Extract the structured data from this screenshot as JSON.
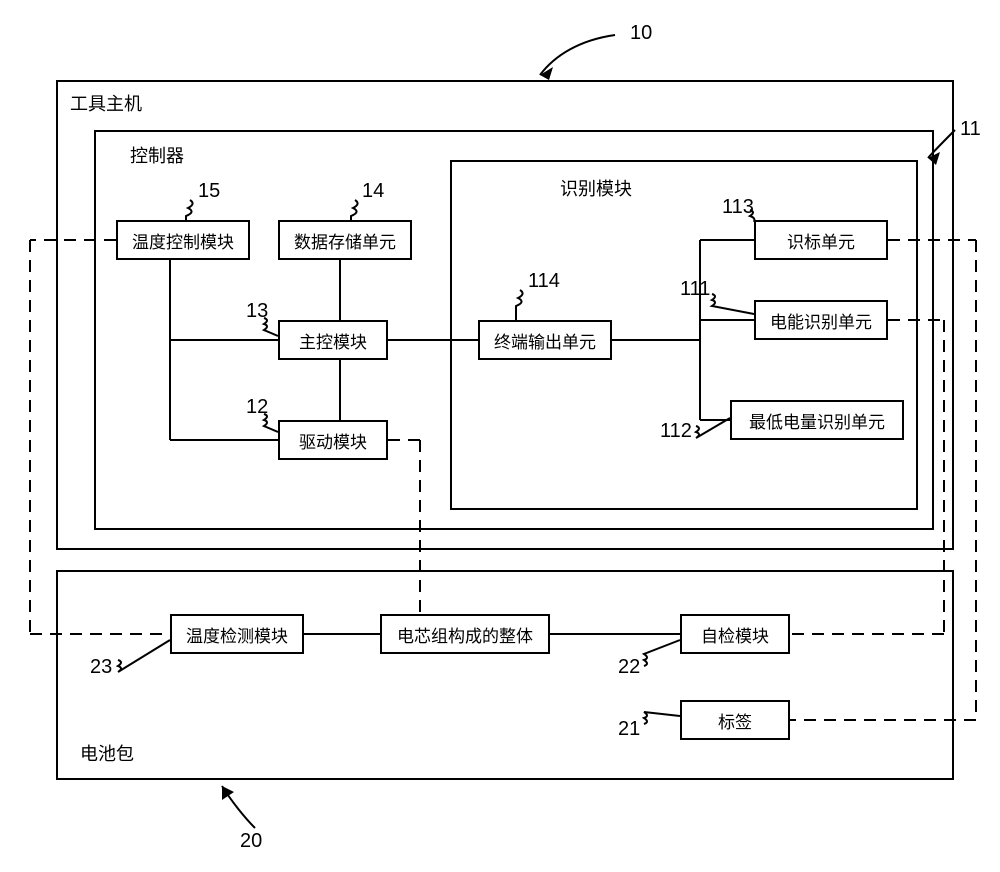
{
  "outer": {
    "tool_host": "工具主机",
    "controller": "控制器",
    "recog_module": "识别模块",
    "battery_pack": "电池包"
  },
  "modules": {
    "temp_ctrl": "温度控制模块",
    "data_store": "数据存储单元",
    "main_ctrl": "主控模块",
    "drive": "驱动模块",
    "term_out": "终端输出单元",
    "id_unit": "识标单元",
    "energy_id": "电能识别单元",
    "min_energy_id": "最低电量识别单元",
    "temp_detect": "温度检测模块",
    "cell_assembly": "电芯组构成的整体",
    "self_check": "自检模块",
    "tag": "标签"
  },
  "refs": {
    "n10": "10",
    "n11": "11",
    "n12": "12",
    "n13": "13",
    "n14": "14",
    "n15": "15",
    "n20": "20",
    "n21": "21",
    "n22": "22",
    "n23": "23",
    "n111": "111",
    "n112": "112",
    "n113": "113",
    "n114": "114"
  }
}
